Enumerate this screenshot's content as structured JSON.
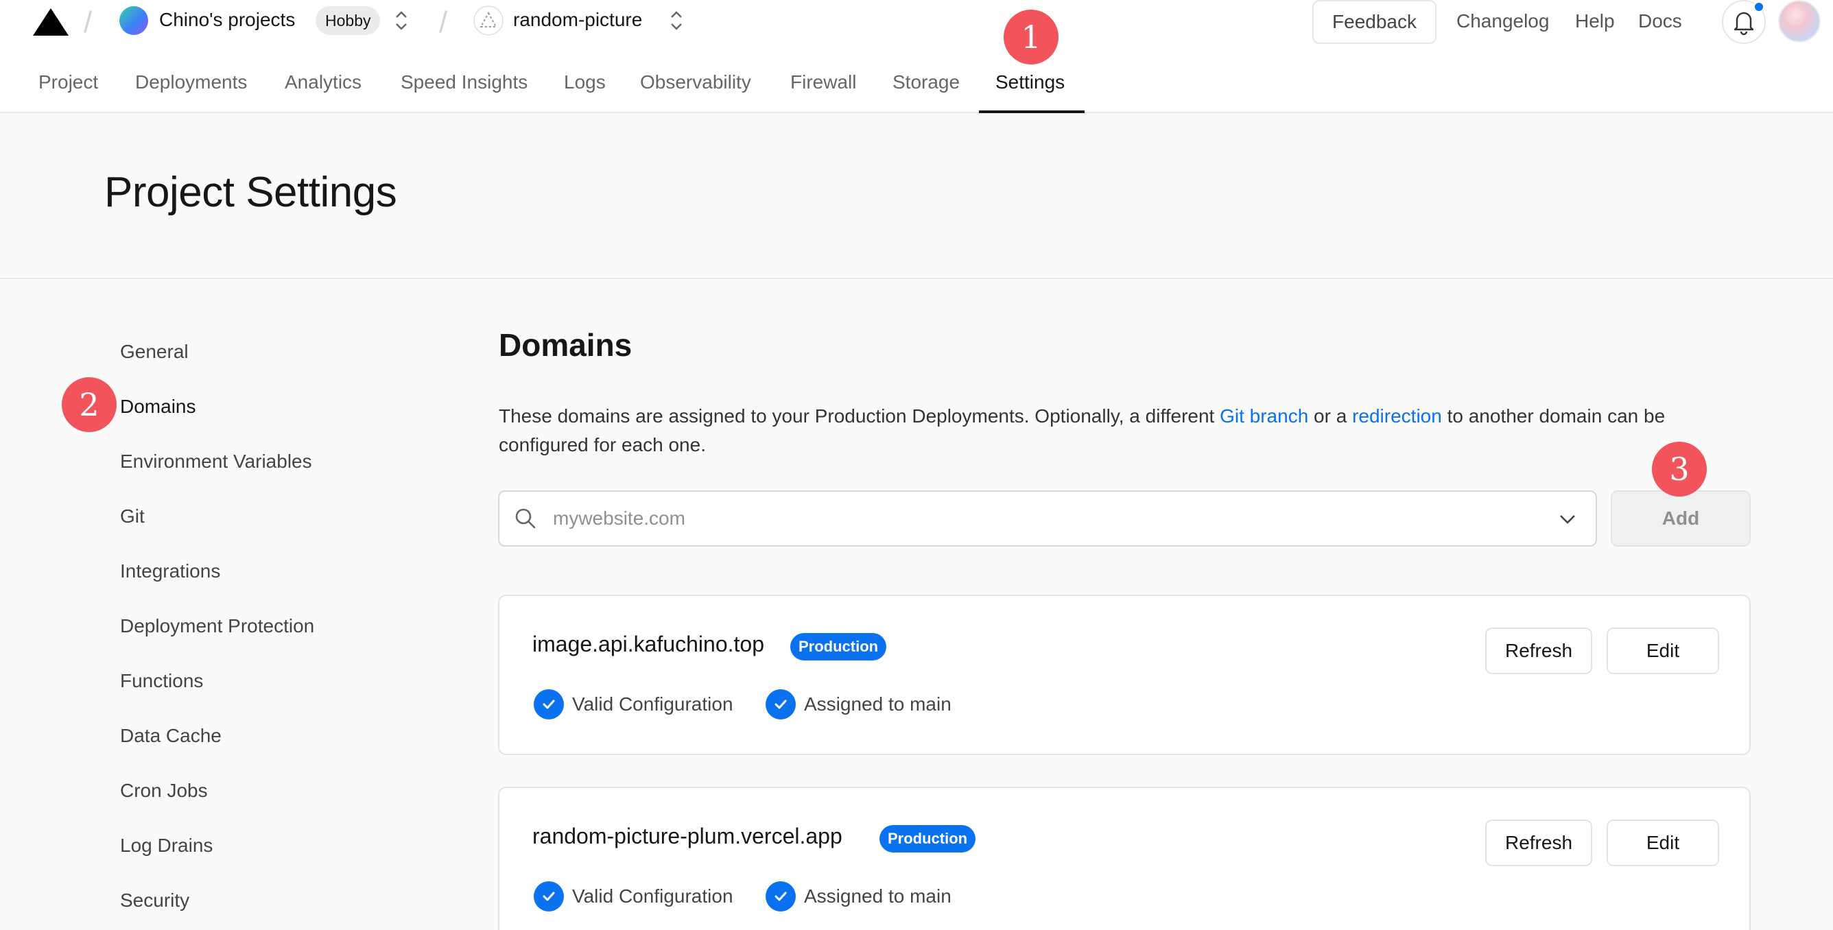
{
  "header": {
    "team_name": "Chino's projects",
    "plan_badge": "Hobby",
    "project_name": "random-picture",
    "feedback_label": "Feedback",
    "links": [
      "Changelog",
      "Help",
      "Docs"
    ]
  },
  "tabs": [
    {
      "label": "Project",
      "active": false
    },
    {
      "label": "Deployments",
      "active": false
    },
    {
      "label": "Analytics",
      "active": false
    },
    {
      "label": "Speed Insights",
      "active": false
    },
    {
      "label": "Logs",
      "active": false
    },
    {
      "label": "Observability",
      "active": false
    },
    {
      "label": "Firewall",
      "active": false
    },
    {
      "label": "Storage",
      "active": false
    },
    {
      "label": "Settings",
      "active": true
    }
  ],
  "markers": [
    "1",
    "2",
    "3"
  ],
  "page": {
    "title": "Project Settings"
  },
  "sidebar": {
    "items": [
      {
        "label": "General",
        "active": false
      },
      {
        "label": "Domains",
        "active": true
      },
      {
        "label": "Environment Variables",
        "active": false
      },
      {
        "label": "Git",
        "active": false
      },
      {
        "label": "Integrations",
        "active": false
      },
      {
        "label": "Deployment Protection",
        "active": false
      },
      {
        "label": "Functions",
        "active": false
      },
      {
        "label": "Data Cache",
        "active": false
      },
      {
        "label": "Cron Jobs",
        "active": false
      },
      {
        "label": "Log Drains",
        "active": false
      },
      {
        "label": "Security",
        "active": false
      }
    ]
  },
  "domains": {
    "title": "Domains",
    "desc_part1": "These domains are assigned to your Production Deployments. Optionally, a different ",
    "desc_link1": "Git branch",
    "desc_part2": " or a ",
    "desc_link2": "redirection",
    "desc_part3": " to another domain can be configured for each one.",
    "search_placeholder": "mywebsite.com",
    "add_label": "Add",
    "entries": [
      {
        "domain": "image.api.kafuchino.top",
        "badge": "Production",
        "refresh_label": "Refresh",
        "edit_label": "Edit",
        "status_config": "Valid Configuration",
        "status_branch": "Assigned to main"
      },
      {
        "domain": "random-picture-plum.vercel.app",
        "badge": "Production",
        "refresh_label": "Refresh",
        "edit_label": "Edit",
        "status_config": "Valid Configuration",
        "status_branch": "Assigned to main"
      }
    ]
  },
  "colors": {
    "accent": "#0a72ef",
    "marker": "#f2545b",
    "text": "#171717"
  }
}
